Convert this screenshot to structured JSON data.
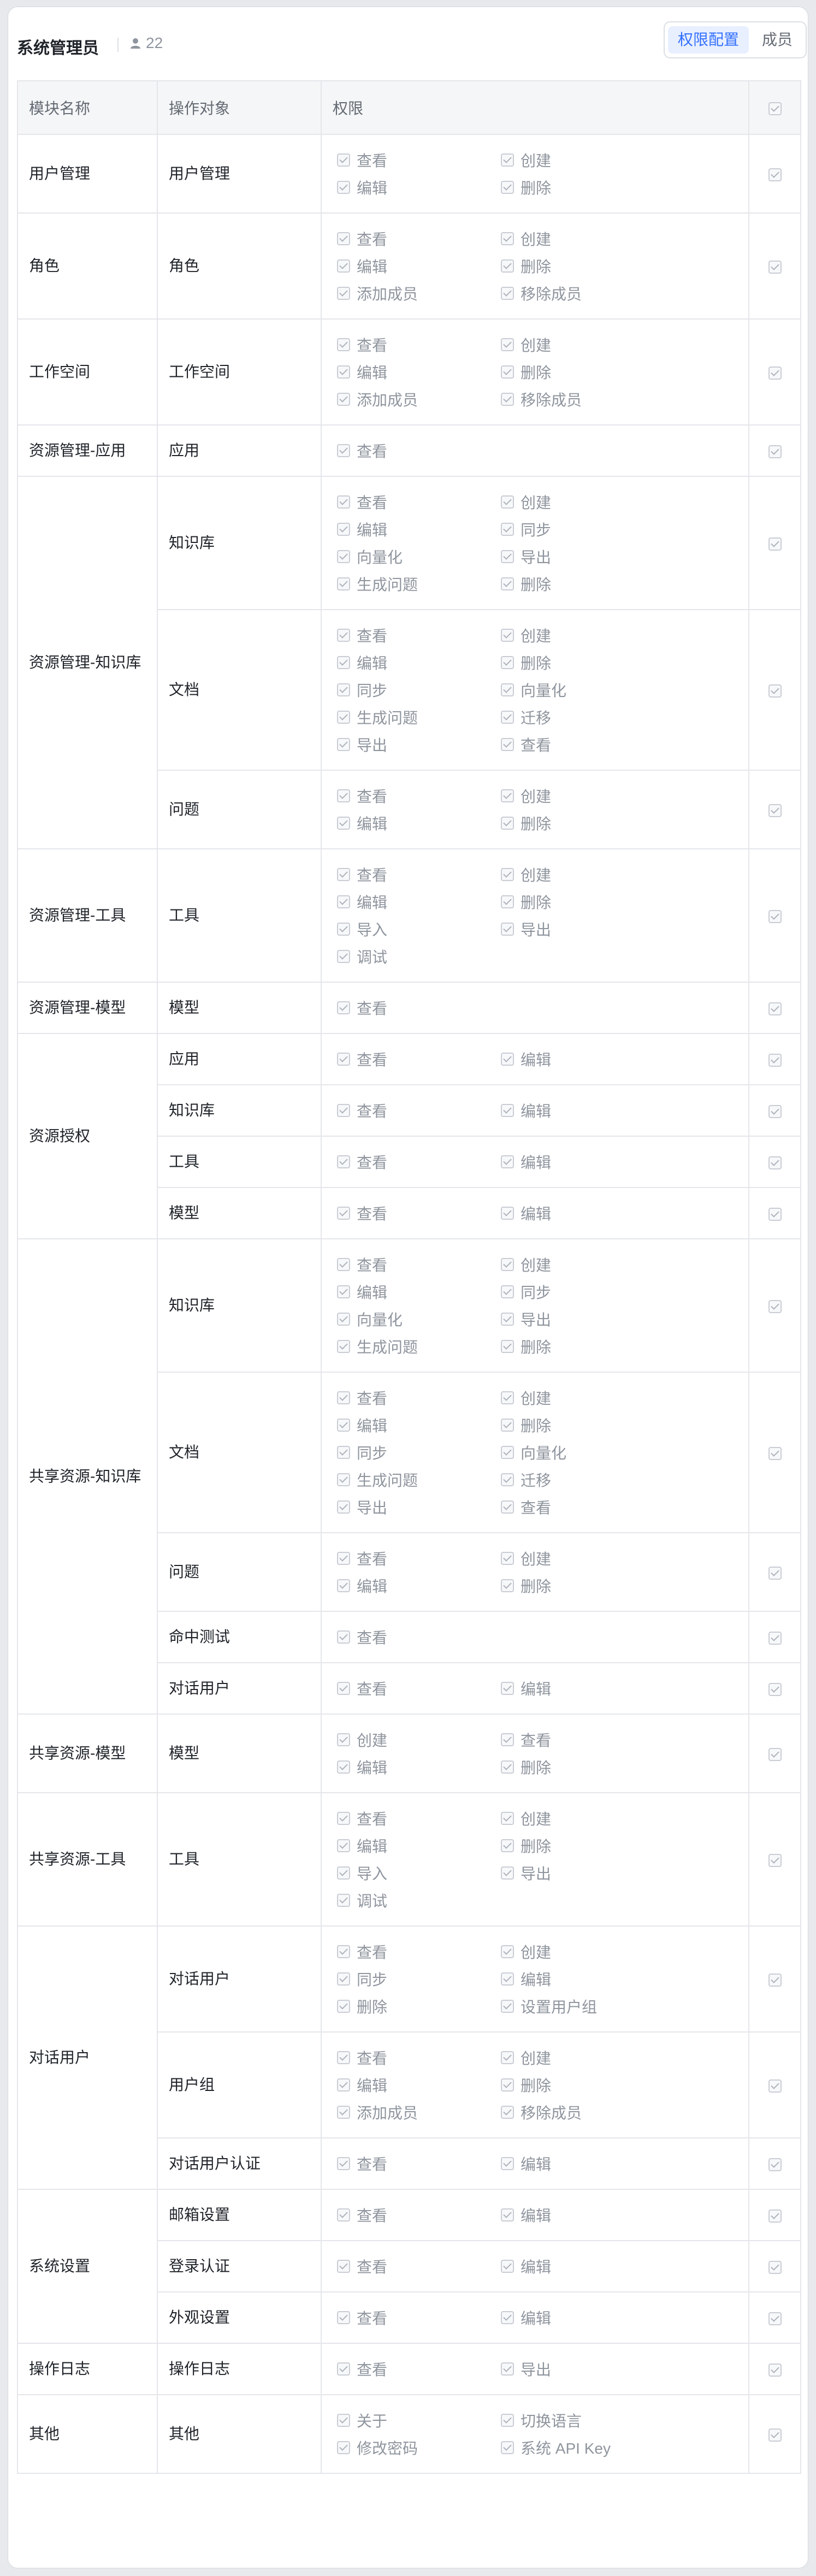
{
  "header": {
    "title": "系统管理员",
    "member_count": "22"
  },
  "tabs": [
    {
      "label": "权限配置"
    },
    {
      "label": "成员"
    }
  ],
  "columns": {
    "module": "模块名称",
    "object": "操作对象",
    "permission": "权限"
  },
  "modules": [
    {
      "name": "用户管理",
      "objects": [
        {
          "name": "用户管理",
          "perms": [
            "查看",
            "创建",
            "编辑",
            "删除"
          ]
        }
      ]
    },
    {
      "name": "角色",
      "objects": [
        {
          "name": "角色",
          "perms": [
            "查看",
            "创建",
            "编辑",
            "删除",
            "添加成员",
            "移除成员"
          ]
        }
      ]
    },
    {
      "name": "工作空间",
      "objects": [
        {
          "name": "工作空间",
          "perms": [
            "查看",
            "创建",
            "编辑",
            "删除",
            "添加成员",
            "移除成员"
          ]
        }
      ]
    },
    {
      "name": "资源管理-应用",
      "objects": [
        {
          "name": "应用",
          "perms": [
            "查看"
          ]
        }
      ]
    },
    {
      "name": "资源管理-知识库",
      "objects": [
        {
          "name": "知识库",
          "perms": [
            "查看",
            "创建",
            "编辑",
            "同步",
            "向量化",
            "导出",
            "生成问题",
            "删除"
          ]
        },
        {
          "name": "文档",
          "perms": [
            "查看",
            "创建",
            "编辑",
            "删除",
            "同步",
            "向量化",
            "生成问题",
            "迁移",
            "导出",
            "查看"
          ]
        },
        {
          "name": "问题",
          "perms": [
            "查看",
            "创建",
            "编辑",
            "删除"
          ]
        }
      ]
    },
    {
      "name": "资源管理-工具",
      "objects": [
        {
          "name": "工具",
          "perms": [
            "查看",
            "创建",
            "编辑",
            "删除",
            "导入",
            "导出",
            "调试"
          ]
        }
      ]
    },
    {
      "name": "资源管理-模型",
      "objects": [
        {
          "name": "模型",
          "perms": [
            "查看"
          ]
        }
      ]
    },
    {
      "name": "资源授权",
      "objects": [
        {
          "name": "应用",
          "perms": [
            "查看",
            "编辑"
          ]
        },
        {
          "name": "知识库",
          "perms": [
            "查看",
            "编辑"
          ]
        },
        {
          "name": "工具",
          "perms": [
            "查看",
            "编辑"
          ]
        },
        {
          "name": "模型",
          "perms": [
            "查看",
            "编辑"
          ]
        }
      ]
    },
    {
      "name": "共享资源-知识库",
      "objects": [
        {
          "name": "知识库",
          "perms": [
            "查看",
            "创建",
            "编辑",
            "同步",
            "向量化",
            "导出",
            "生成问题",
            "删除"
          ]
        },
        {
          "name": "文档",
          "perms": [
            "查看",
            "创建",
            "编辑",
            "删除",
            "同步",
            "向量化",
            "生成问题",
            "迁移",
            "导出",
            "查看"
          ]
        },
        {
          "name": "问题",
          "perms": [
            "查看",
            "创建",
            "编辑",
            "删除"
          ]
        },
        {
          "name": "命中测试",
          "perms": [
            "查看"
          ]
        },
        {
          "name": "对话用户",
          "perms": [
            "查看",
            "编辑"
          ]
        }
      ]
    },
    {
      "name": "共享资源-模型",
      "objects": [
        {
          "name": "模型",
          "perms": [
            "创建",
            "查看",
            "编辑",
            "删除"
          ]
        }
      ]
    },
    {
      "name": "共享资源-工具",
      "objects": [
        {
          "name": "工具",
          "perms": [
            "查看",
            "创建",
            "编辑",
            "删除",
            "导入",
            "导出",
            "调试"
          ]
        }
      ]
    },
    {
      "name": "对话用户",
      "objects": [
        {
          "name": "对话用户",
          "perms": [
            "查看",
            "创建",
            "同步",
            "编辑",
            "删除",
            "设置用户组"
          ]
        },
        {
          "name": "用户组",
          "perms": [
            "查看",
            "创建",
            "编辑",
            "删除",
            "添加成员",
            "移除成员"
          ]
        },
        {
          "name": "对话用户认证",
          "perms": [
            "查看",
            "编辑"
          ]
        }
      ]
    },
    {
      "name": "系统设置",
      "objects": [
        {
          "name": "邮箱设置",
          "perms": [
            "查看",
            "编辑"
          ]
        },
        {
          "name": "登录认证",
          "perms": [
            "查看",
            "编辑"
          ]
        },
        {
          "name": "外观设置",
          "perms": [
            "查看",
            "编辑"
          ]
        }
      ]
    },
    {
      "name": "操作日志",
      "objects": [
        {
          "name": "操作日志",
          "perms": [
            "查看",
            "导出"
          ]
        }
      ]
    },
    {
      "name": "其他",
      "objects": [
        {
          "name": "其他",
          "perms": [
            "关于",
            "切换语言",
            "修改密码",
            "系统 API Key"
          ]
        }
      ]
    }
  ]
}
